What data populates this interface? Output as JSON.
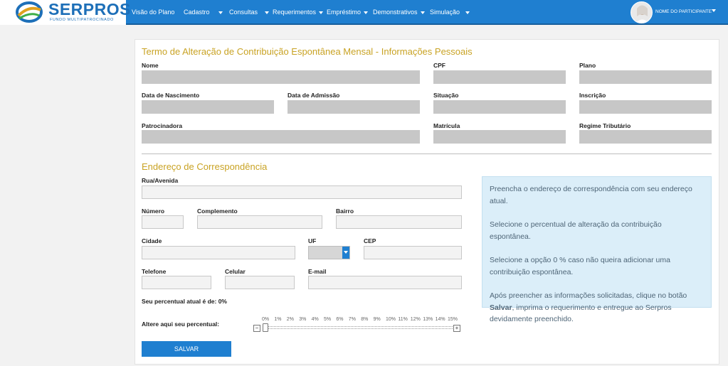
{
  "brand": {
    "name": "SERPROS",
    "subtitle": "FUNDO MULTIPATROCINADO"
  },
  "nav": {
    "items": [
      {
        "label": "Visão do Plano",
        "dropdown": false
      },
      {
        "label": "Cadastro",
        "dropdown": true
      },
      {
        "label": "Consultas",
        "dropdown": true
      },
      {
        "label": "Requerimentos",
        "dropdown": true
      },
      {
        "label": "Empréstimo",
        "dropdown": true
      },
      {
        "label": "Demonstrativos",
        "dropdown": true
      },
      {
        "label": "Simulação",
        "dropdown": true
      }
    ],
    "user_name": "NOME DO PARTICIPANTE"
  },
  "personal": {
    "title": "Termo de Alteração de Contribuição Espontânea Mensal - Informações Pessoais",
    "labels": {
      "nome": "Nome",
      "cpf": "CPF",
      "plano": "Plano",
      "nascimento": "Data de Nascimento",
      "admissao": "Data de Admissão",
      "situacao": "Situação",
      "inscricao": "Inscrição",
      "patrocinadora": "Patrocinadora",
      "matricula": "Matrícula",
      "regime": "Regime Tributário"
    }
  },
  "address": {
    "title": "Endereço de Correspondência",
    "labels": {
      "rua": "Rua/Avenida",
      "numero": "Número",
      "complemento": "Complemento",
      "bairro": "Bairro",
      "cidade": "Cidade",
      "uf": "UF",
      "cep": "CEP",
      "telefone": "Telefone",
      "celular": "Celular",
      "email": "E-mail"
    },
    "uf_value": ""
  },
  "contribution": {
    "current_text": "Seu percentual atual é de: 0%",
    "change_label": "Altere aqui seu percentual:",
    "ticks": [
      "0%",
      "1%",
      "2%",
      "3%",
      "4%",
      "5%",
      "6%",
      "7%",
      "8%",
      "9%",
      "10%",
      "11%",
      "12%",
      "13%",
      "14%",
      "15%"
    ],
    "slider_value_percent": 0,
    "minus": "−",
    "plus": "+"
  },
  "save_label": "SALVAR",
  "info": {
    "p1": "Preencha o endereço de correspondência com seu endereço atual.",
    "p2": "Selecione o percentual de alteração da contribuição espontânea.",
    "p3": "Selecione a opção 0 % caso não queira adicionar uma contribuição espontânea.",
    "p4_before": "Após preencher as informações solicitadas, clique no botão ",
    "p4_bold": "Salvar",
    "p4_after": ", imprima o requerimento e entregue ao Serpros devidamente preenchido."
  },
  "colors": {
    "primary": "#1f7fd0",
    "section_title": "#c9a324",
    "info_bg": "#dbeef9"
  }
}
